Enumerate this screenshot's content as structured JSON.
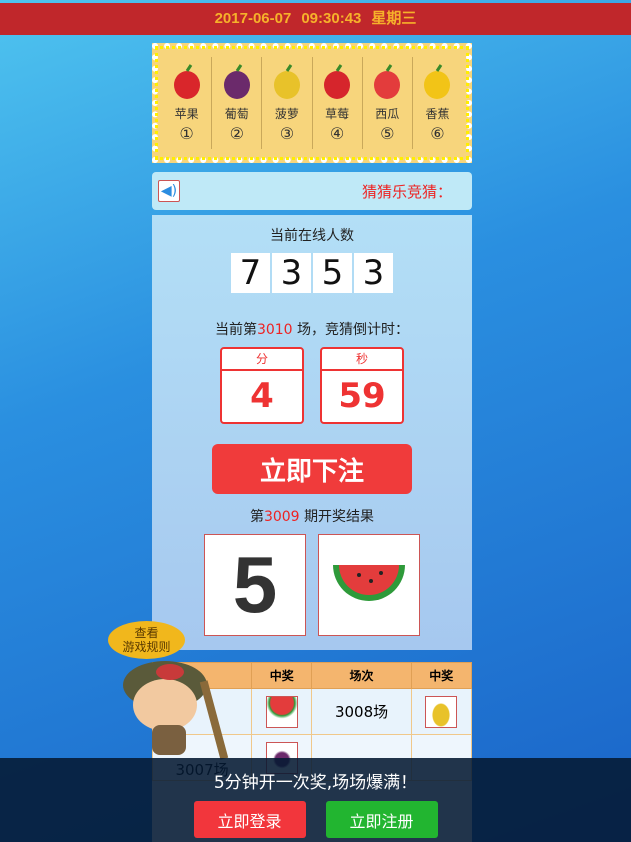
{
  "header": {
    "date": "2017-06-07",
    "time": "09:30:43",
    "weekday": "星期三"
  },
  "fruits": [
    {
      "name": "苹果",
      "num": "①",
      "icon": "apple-icon",
      "color": "#d9262b"
    },
    {
      "name": "葡萄",
      "num": "②",
      "icon": "grape-icon",
      "color": "#6b2a6b"
    },
    {
      "name": "菠萝",
      "num": "③",
      "icon": "pineapple-icon",
      "color": "#e8c22a"
    },
    {
      "name": "草莓",
      "num": "④",
      "icon": "strawberry-icon",
      "color": "#d6252c"
    },
    {
      "name": "西瓜",
      "num": "⑤",
      "icon": "watermelon-icon",
      "color": "#e33c3c"
    },
    {
      "name": "香蕉",
      "num": "⑥",
      "icon": "banana-icon",
      "color": "#f2c417"
    }
  ],
  "notice": {
    "text": "猜猜乐竞猜："
  },
  "online": {
    "label": "当前在线人数",
    "digits": [
      "7",
      "3",
      "5",
      "3"
    ]
  },
  "round": {
    "prefix": "当前第",
    "number": "3010",
    "suffix": " 场，竞猜倒计时："
  },
  "countdown": {
    "min_label": "分",
    "min": "4",
    "sec_label": "秒",
    "sec": "59"
  },
  "bet_button": "立即下注",
  "result": {
    "prefix": "第",
    "period": "3009",
    "suffix": " 期开奖结果",
    "number": "5",
    "fruit": "watermelon-icon"
  },
  "table": {
    "headers": [
      "",
      "中奖",
      "场次",
      "中奖"
    ],
    "rows": [
      {
        "c0": "",
        "c1": "watermelon-icon",
        "c2": "3008场",
        "c3": "pineapple-icon"
      },
      {
        "c0": "3007场",
        "c1": "grape-icon",
        "c2": "",
        "c3": ""
      }
    ]
  },
  "rules_button": [
    "查看",
    "游戏规则"
  ],
  "footer": {
    "slogan": "5分钟开一次奖,场场爆满！",
    "login": "立即登录",
    "register": "立即注册"
  }
}
